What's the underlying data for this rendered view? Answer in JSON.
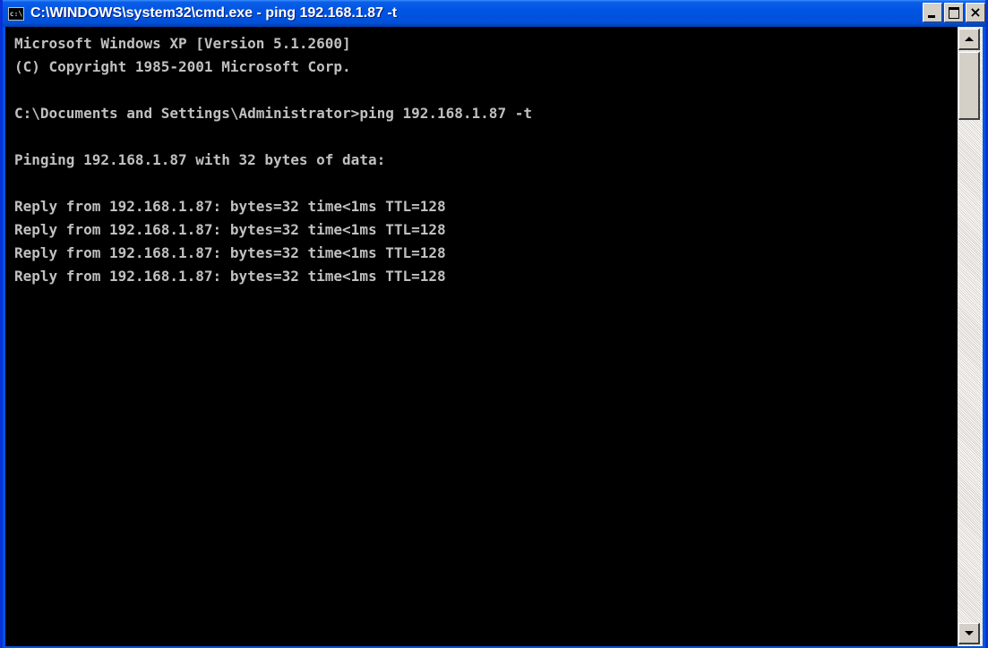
{
  "window": {
    "title": "C:\\WINDOWS\\system32\\cmd.exe - ping 192.168.1.87 -t",
    "icon": "cmd-console-icon",
    "icon_label": "c:\\",
    "buttons": {
      "minimize": "minimize-icon",
      "maximize": "maximize-icon",
      "close": "×"
    }
  },
  "console": {
    "lines": [
      "Microsoft Windows XP [Version 5.1.2600]",
      "(C) Copyright 1985-2001 Microsoft Corp.",
      "",
      "C:\\Documents and Settings\\Administrator>ping 192.168.1.87 -t",
      "",
      "Pinging 192.168.1.87 with 32 bytes of data:",
      "",
      "Reply from 192.168.1.87: bytes=32 time<1ms TTL=128",
      "Reply from 192.168.1.87: bytes=32 time<1ms TTL=128",
      "Reply from 192.168.1.87: bytes=32 time<1ms TTL=128",
      "Reply from 192.168.1.87: bytes=32 time<1ms TTL=128"
    ]
  },
  "colors": {
    "titlebar": "#0054e3",
    "console_bg": "#000000",
    "console_fg": "#c0c0c0"
  }
}
